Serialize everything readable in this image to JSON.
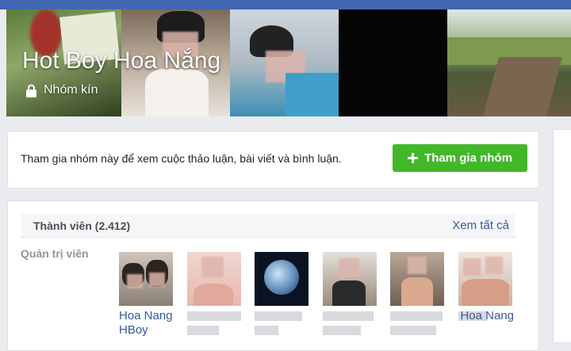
{
  "group": {
    "name": "Hot Boy Hoa Nắng",
    "privacy": "Nhóm kín"
  },
  "join": {
    "prompt": "Tham gia nhóm này để xem cuộc thảo luận, bài viết và bình luận.",
    "button_label": "Tham gia nhóm",
    "button_icon": "plus-icon"
  },
  "members": {
    "title": "Thành viên (2.412)",
    "see_all": "Xem tất cả",
    "admins_label": "Quản trị viên",
    "admins": [
      {
        "name": "Hoa Nang HBoy"
      },
      {
        "name": ""
      },
      {
        "name": ""
      },
      {
        "name": ""
      },
      {
        "name": ""
      },
      {
        "name": "Hoa Nang"
      }
    ]
  },
  "colors": {
    "topbar": "#4267b2",
    "join_button": "#42b72a",
    "link": "#365899"
  }
}
